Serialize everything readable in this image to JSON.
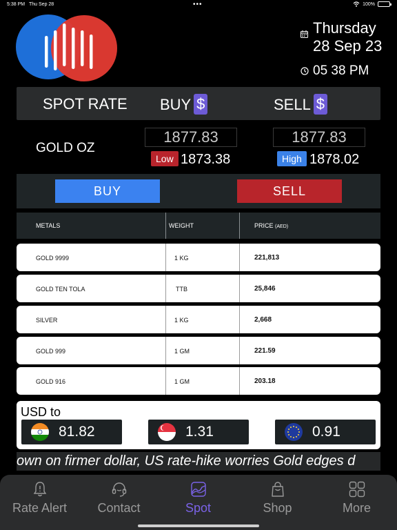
{
  "status_bar": {
    "time": "5:38 PM",
    "date": "Thu Sep 28",
    "dots": "•••",
    "battery": "100%",
    "battery_level": 1.0
  },
  "header": {
    "day": "Thursday",
    "date": "28 Sep 23",
    "time": "05 38 PM"
  },
  "rate_header": {
    "spot_rate": "SPOT RATE",
    "buy": "BUY",
    "sell": "SELL",
    "currency_symbol": "$"
  },
  "gold_oz": {
    "name": "GOLD OZ",
    "buy_price": "1877.83",
    "sell_price": "1877.83",
    "low_label": "Low",
    "low_value": "1873.38",
    "high_label": "High",
    "high_value": "1878.02"
  },
  "actions": {
    "buy_label": "BUY",
    "sell_label": "SELL"
  },
  "table": {
    "headers": {
      "metals": "METALS",
      "weight": "WEIGHT",
      "price": "PRICE",
      "price_unit": "(AED)"
    },
    "rows": [
      {
        "metal": "GOLD 9999",
        "weight": "1 KG",
        "price": "221,813"
      },
      {
        "metal": "GOLD TEN TOLA",
        "weight": "TTB",
        "price": "25,846"
      },
      {
        "metal": "SILVER",
        "weight": "1 KG",
        "price": "2,668"
      },
      {
        "metal": "GOLD 999",
        "weight": "1 GM",
        "price": "221.59"
      },
      {
        "metal": "GOLD 916",
        "weight": "1 GM",
        "price": "203.18"
      }
    ]
  },
  "usd": {
    "label": "USD to",
    "rates": [
      {
        "flag": "india-flag-icon",
        "value": "81.82"
      },
      {
        "flag": "singapore-flag-icon",
        "value": "1.31"
      },
      {
        "flag": "eu-flag-icon",
        "value": "0.91"
      }
    ]
  },
  "ticker": {
    "text": "own on firmer dollar, US rate-hike worries  Gold edges d"
  },
  "tabs": [
    {
      "label": "Rate Alert",
      "icon": "bell-icon"
    },
    {
      "label": "Contact",
      "icon": "headset-icon"
    },
    {
      "label": "Spot",
      "icon": "chart-icon",
      "active": true
    },
    {
      "label": "Shop",
      "icon": "shopping-bag-icon"
    },
    {
      "label": "More",
      "icon": "grid-icon"
    }
  ],
  "colors": {
    "accent": "#7b63e8",
    "buy": "#3b82f0",
    "sell": "#b8252b",
    "logo_blue": "#1e6fd8",
    "logo_red": "#e03a32"
  }
}
